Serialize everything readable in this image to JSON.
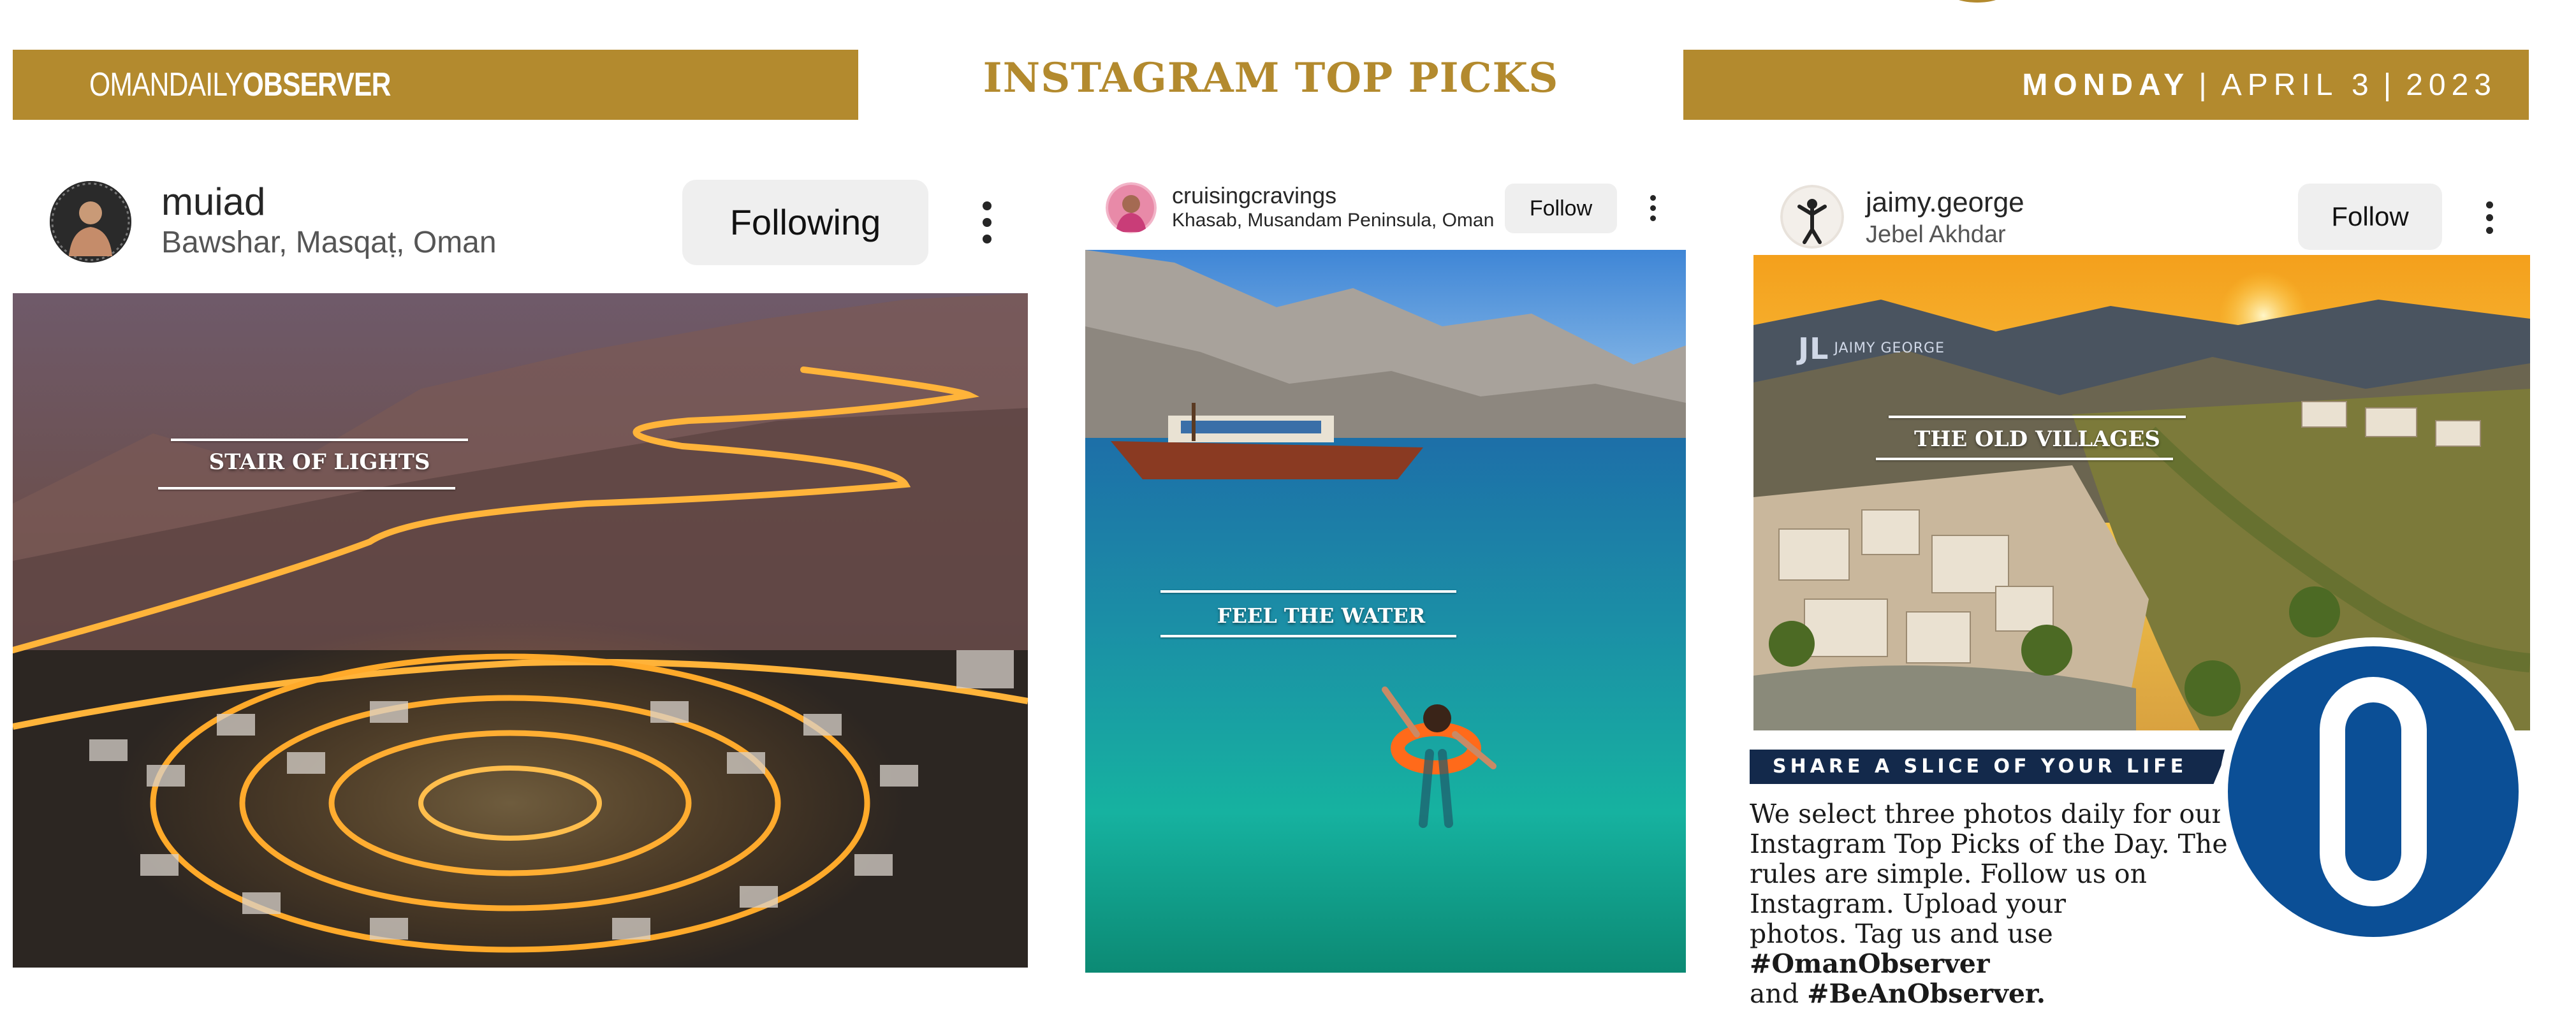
{
  "masthead": {
    "brand_light": "OMANDAILY",
    "brand_bold": "OBSERVER",
    "title": "INSTAGRAM TOP PICKS",
    "day": "MONDAY",
    "date_sep": "|",
    "month_day": "APRIL 3",
    "year": "2023"
  },
  "colors": {
    "gold": "#b38a2e",
    "navy": "#13294b",
    "logo_blue": "#0b4f96"
  },
  "posts": [
    {
      "username": "muiad",
      "location": "Bawshar, Masqaṭ, Oman",
      "follow_label": "Following",
      "caption": "STAIR OF LIGHTS",
      "menu_icon": "more-vertical-icon"
    },
    {
      "username": "cruisingcravings",
      "location": "Khasab, Musandam Peninsula, Oman",
      "follow_label": "Follow",
      "caption": "FEEL THE WATER",
      "menu_icon": "more-vertical-icon"
    },
    {
      "username": "jaimy.george",
      "location": "Jebel Akhdar",
      "follow_label": "Follow",
      "caption": "THE OLD VILLAGES",
      "watermark": "JAIMY GEORGE",
      "menu_icon": "more-vertical-icon"
    }
  ],
  "promo": {
    "heading": "SHARE A SLICE OF YOUR LIFE",
    "line1": "We select three photos daily for our",
    "line2": "Instagram Top Picks of the Day. The",
    "line3": "rules are simple. Follow us on",
    "line4": "Instagram. Upload your",
    "line5_pre": "photos. Tag us and use ",
    "tag1": "#OmanObserver",
    "line6_pre": "and ",
    "tag2": "#BeAnObserver."
  },
  "logo": {
    "icon": "observer-o-logo-icon"
  }
}
